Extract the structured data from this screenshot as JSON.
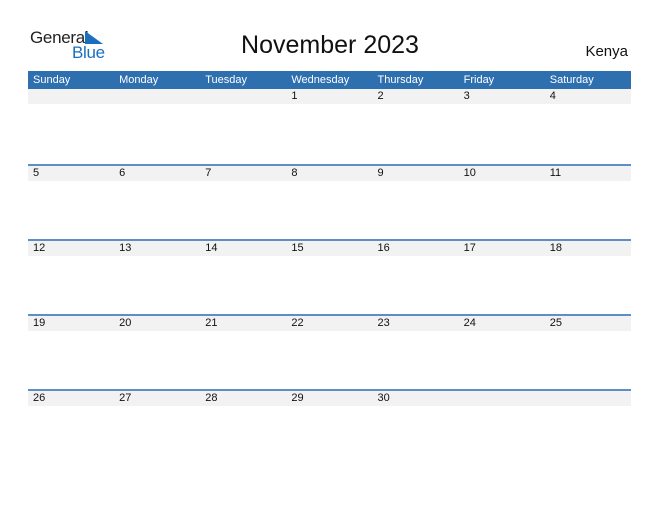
{
  "brand": {
    "line1": "General",
    "line2": "Blue",
    "color": "#1a6fbf"
  },
  "title": "November 2023",
  "country": "Kenya",
  "header_color": "#2e6fb0",
  "weekdays": [
    "Sunday",
    "Monday",
    "Tuesday",
    "Wednesday",
    "Thursday",
    "Friday",
    "Saturday"
  ],
  "weeks": [
    [
      "",
      "",
      "",
      "1",
      "2",
      "3",
      "4"
    ],
    [
      "5",
      "6",
      "7",
      "8",
      "9",
      "10",
      "11"
    ],
    [
      "12",
      "13",
      "14",
      "15",
      "16",
      "17",
      "18"
    ],
    [
      "19",
      "20",
      "21",
      "22",
      "23",
      "24",
      "25"
    ],
    [
      "26",
      "27",
      "28",
      "29",
      "30",
      "",
      ""
    ]
  ]
}
